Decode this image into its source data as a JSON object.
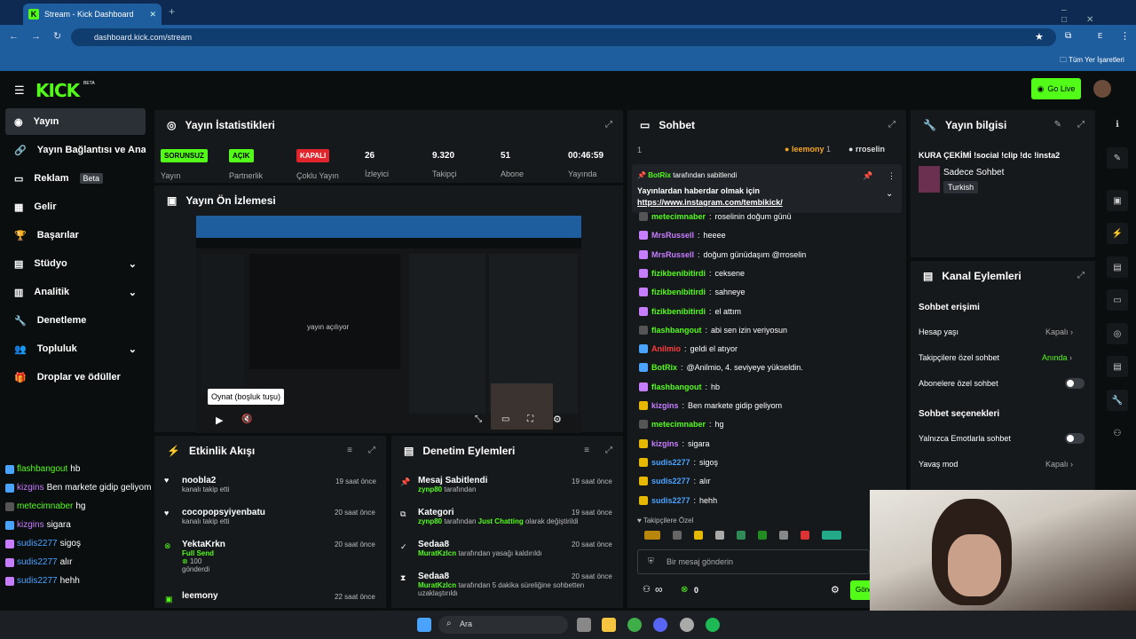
{
  "browser": {
    "tab_title": "Stream - Kick Dashboard",
    "url": "dashboard.kick.com/stream",
    "bookmarks_label": "Tüm Yer İşaretleri",
    "profile": "E"
  },
  "header": {
    "logo": "KICK",
    "beta": "BETA",
    "golive": "Go Live"
  },
  "sidebar": {
    "items": [
      {
        "label": "Yayın"
      },
      {
        "label": "Yayın Bağlantısı ve Anahtarı"
      },
      {
        "label": "Reklam",
        "badge": "Beta"
      },
      {
        "label": "Gelir"
      },
      {
        "label": "Başarılar"
      },
      {
        "label": "Stüdyo"
      },
      {
        "label": "Analitik"
      },
      {
        "label": "Denetleme"
      },
      {
        "label": "Topluluk"
      },
      {
        "label": "Droplar ve ödüller"
      }
    ]
  },
  "stats": {
    "title": "Yayın İstatistikleri",
    "items": [
      {
        "value": "SORUNSUZ",
        "label": "Yayın"
      },
      {
        "value": "AÇIK",
        "label": "Partnerlik"
      },
      {
        "value": "KAPALI",
        "label": "Çoklu Yayın"
      },
      {
        "value": "26",
        "label": "İzleyici"
      },
      {
        "value": "9.320",
        "label": "Takipçi"
      },
      {
        "value": "51",
        "label": "Abone"
      },
      {
        "value": "00:46:59",
        "label": "Yayında"
      }
    ]
  },
  "preview": {
    "title": "Yayın Ön İzlemesi",
    "tooltip": "Oynat (boşluk tuşu)",
    "inner_text": "yayın açılıyor"
  },
  "activity": {
    "title": "Etkinlik Akışı",
    "items": [
      {
        "name": "noobla2",
        "sub": "kanalı takip etti",
        "time": "19 saat önce"
      },
      {
        "name": "cocopopsyiyenbatu",
        "sub": "kanalı takip etti",
        "time": "20 saat önce"
      },
      {
        "name": "YektaKrkn",
        "sub": "Full Send",
        "extra": "100",
        "extra2": "gönderdi",
        "time": "20 saat önce"
      },
      {
        "name": "leemony",
        "time": "22 saat önce"
      }
    ]
  },
  "moderation": {
    "title": "Denetim Eylemleri",
    "items": [
      {
        "title": "Mesaj Sabitlendi",
        "user": "zynp80",
        "text": "tarafından",
        "time": "19 saat önce"
      },
      {
        "title": "Kategori",
        "user": "zynp80",
        "text": "tarafından",
        "highlight": "Just Chatting",
        "text2": "olarak değiştirildi",
        "time": "19 saat önce"
      },
      {
        "title": "Sedaa8",
        "user": "MuratKzlcn",
        "text": "tarafından yasağı kaldırıldı",
        "time": "20 saat önce"
      },
      {
        "title": "Sedaa8",
        "user": "MuratKzlcn",
        "text": "tarafından 5 dakika süreliğine sohbetten uzaklaştırıldı",
        "time": "20 saat önce"
      }
    ]
  },
  "chat": {
    "title": "Sohbet",
    "count": "1",
    "top": [
      {
        "name": "leemony",
        "n": "1"
      },
      {
        "name": "rroselin",
        "n": ""
      }
    ],
    "pinned": {
      "by": "BotRix",
      "by_text": "tarafından sabitlendi",
      "text": "Yayınlardan haberdar olmak için",
      "link": "https://www.instagram.com/tembikick/"
    },
    "messages": [
      {
        "user": "metecimnaber",
        "text": "roselinin doğum günü",
        "color": "#53fc18"
      },
      {
        "user": "MrsRussell",
        "text": "heeee",
        "color": "#c77dff"
      },
      {
        "user": "MrsRussell",
        "text": "doğum günüdaşım @rroselin",
        "color": "#c77dff"
      },
      {
        "user": "fizikbenibitirdi",
        "text": "ceksene",
        "color": "#53fc18"
      },
      {
        "user": "fizikbenibitirdi",
        "text": "sahneye",
        "color": "#53fc18"
      },
      {
        "user": "fizikbenibitirdi",
        "text": "el attım",
        "color": "#53fc18"
      },
      {
        "user": "flashbangout",
        "text": "abi sen izin veriyosun",
        "color": "#53fc18"
      },
      {
        "user": "Anilmio",
        "text": "geldi el atıyor",
        "color": "#ff3b3b"
      },
      {
        "user": "BotRix",
        "text": "@Anilmio, 4. seviyeye yükseldin.",
        "color": "#53fc18"
      },
      {
        "user": "flashbangout",
        "text": "hb",
        "color": "#53fc18"
      },
      {
        "user": "kizgins",
        "text": "Ben markete gidip geliyom",
        "color": "#c77dff"
      },
      {
        "user": "metecimnaber",
        "text": "hg",
        "color": "#53fc18"
      },
      {
        "user": "kizgins",
        "text": "sigara",
        "color": "#c77dff"
      },
      {
        "user": "sudis2277",
        "text": "sigoş",
        "color": "#4aa3ff"
      },
      {
        "user": "sudis2277",
        "text": "alır",
        "color": "#4aa3ff"
      },
      {
        "user": "sudis2277",
        "text": "hehh",
        "color": "#4aa3ff"
      }
    ],
    "followers_only": "Takipçilere Özel",
    "input_placeholder": "Bir mesaj gönderin",
    "infinity": "∞",
    "points": "0",
    "send": "Gönder"
  },
  "info": {
    "title": "Yayın bilgisi",
    "stream_title": "KURA ÇEKİMİ !social !clip !dc !insta2",
    "category": "Sadece Sohbet",
    "tag": "Turkish"
  },
  "channel": {
    "title": "Kanal Eylemleri",
    "chat_access": "Sohbet erişimi",
    "rows": [
      {
        "label": "Hesap yaşı",
        "value": "Kapalı"
      },
      {
        "label": "Takipçilere özel sohbet",
        "value": "Anında"
      },
      {
        "label": "Abonelere özel sohbet",
        "value": ""
      }
    ],
    "chat_options": "Sohbet seçenekleri",
    "rows2": [
      {
        "label": "Yalnızca Emotlarla sohbet",
        "value": ""
      },
      {
        "label": "Yavaş mod",
        "value": "Kapalı"
      }
    ]
  },
  "overlay_chat": [
    {
      "user": "flashbangout",
      "text": "hb",
      "color": "#53fc18"
    },
    {
      "user": "kizgins",
      "text": "Ben markete gidip geliyom",
      "color": "#c77dff"
    },
    {
      "user": "metecimnaber",
      "text": "hg",
      "color": "#53fc18"
    },
    {
      "user": "kizgins",
      "text": "sigara",
      "color": "#c77dff"
    },
    {
      "user": "sudis2277",
      "text": "sigoş",
      "color": "#4aa3ff"
    },
    {
      "user": "sudis2277",
      "text": "alır",
      "color": "#4aa3ff"
    },
    {
      "user": "sudis2277",
      "text": "hehh",
      "color": "#4aa3ff"
    }
  ],
  "taskbar": {
    "search": "Ara"
  }
}
